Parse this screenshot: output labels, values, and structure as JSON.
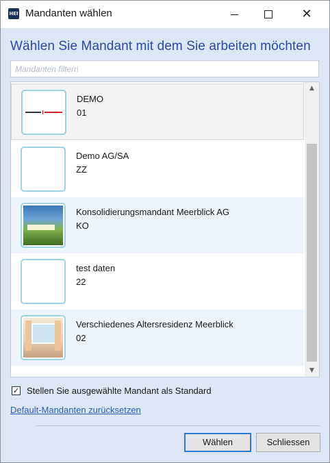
{
  "window": {
    "app_icon_text": "HEI",
    "title": "Mandanten wählen"
  },
  "heading": "Wählen Sie Mandant mit dem Sie arbeiten möchten",
  "filter": {
    "value": "",
    "placeholder": "Mandanten filtern"
  },
  "clients": [
    {
      "name": "DEMO",
      "code": "01",
      "selected": true,
      "thumbnail": "demo-logo"
    },
    {
      "name": "Demo AG/SA",
      "code": "ZZ",
      "selected": false,
      "thumbnail": "none"
    },
    {
      "name": "Konsolidierungsmandant Meerblick AG",
      "code": "KO",
      "selected": false,
      "thumbnail": "landscape-image"
    },
    {
      "name": "test daten",
      "code": "22",
      "selected": false,
      "thumbnail": "none"
    },
    {
      "name": "Verschiedenes Altersresidenz Meerblick",
      "code": "02",
      "selected": false,
      "thumbnail": "room-image"
    }
  ],
  "default_checkbox": {
    "checked": true,
    "label": "Stellen Sie ausgewählte Mandant als Standard"
  },
  "reset_link": "Default-Mandanten zurücksetzen",
  "buttons": {
    "select": "Wählen",
    "close": "Schliessen"
  },
  "colors": {
    "heading": "#2b4aa0",
    "link": "#2b5fb4",
    "thumbnail_border": "#9fd3e1",
    "default_button_border": "#2c7ad6"
  }
}
